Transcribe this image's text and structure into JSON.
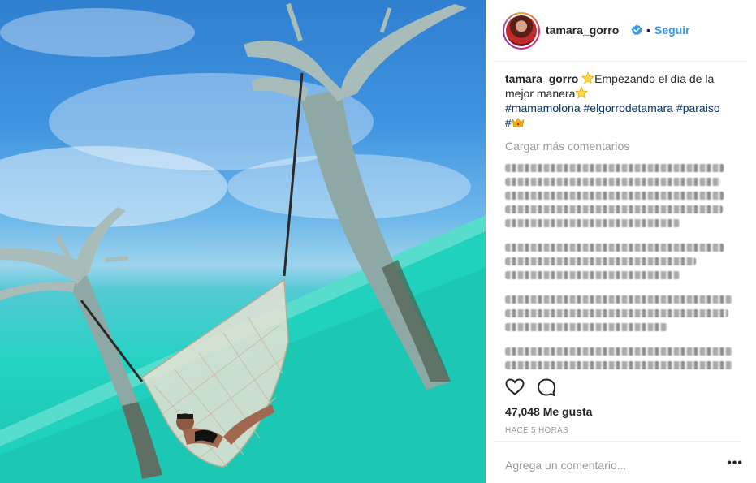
{
  "post": {
    "username": "tamara_gorro",
    "follow_label": "Seguir",
    "separator": "•",
    "caption": {
      "username": "tamara_gorro",
      "text_part1": "Empezando el día de la mejor manera",
      "hashtags": [
        "#mamamolona",
        "#elgorrodetamara",
        "#paraiso",
        "#"
      ]
    },
    "load_more_label": "Cargar más comentarios",
    "likes_label": "47,048 Me gusta",
    "time_label": "HACE 5 HORAS",
    "comment_placeholder": "Agrega un comentario...",
    "more_options_label": "•••"
  },
  "icons": {
    "verified": "verified-badge-icon",
    "like": "heart-icon",
    "comment": "speech-bubble-icon",
    "star": "star-emoji",
    "crown": "crown-emoji"
  },
  "colors": {
    "link_blue": "#3897f0",
    "hashtag": "#003569",
    "muted": "#999999",
    "text": "#262626"
  }
}
